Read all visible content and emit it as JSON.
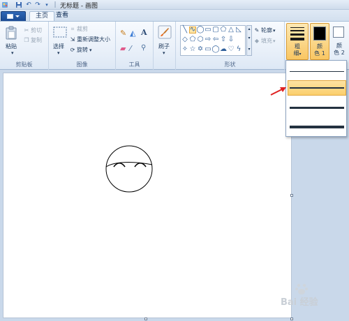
{
  "window": {
    "title": "无标题 - 画图"
  },
  "tabs": [
    {
      "label": "主页"
    },
    {
      "label": "查看"
    }
  ],
  "clipboard": {
    "paste_label": "粘贴",
    "cut_label": "剪切",
    "copy_label": "复制",
    "group_label": "剪贴板"
  },
  "image": {
    "select_label": "选择",
    "crop_label": "裁剪",
    "resize_label": "重新调整大小",
    "rotate_label": "旋转",
    "group_label": "图像"
  },
  "tools": {
    "group_label": "工具",
    "text_tool": "A"
  },
  "brushes": {
    "label": "刷子"
  },
  "shapes": {
    "outline_label": "轮廓",
    "fill_label": "填充",
    "group_label": "形状"
  },
  "size": {
    "label_line1": "粗",
    "label_line2": "细"
  },
  "color1": {
    "label_line1": "颜",
    "label_line2": "色 1",
    "value": "#000000"
  },
  "color2": {
    "label_line1": "颜",
    "label_line2": "色 2",
    "value": "#ffffff"
  },
  "size_dropdown": {
    "options": [
      {
        "thickness": 1,
        "selected": false
      },
      {
        "thickness": 3,
        "selected": true
      },
      {
        "thickness": 5,
        "selected": false
      },
      {
        "thickness": 8,
        "selected": false
      }
    ]
  },
  "watermark": {
    "text": "Bai 经验"
  },
  "colors": {
    "selection_highlight": "#fbcf6c",
    "arrow": "#e02020",
    "title_accent": "#2f67b6"
  }
}
